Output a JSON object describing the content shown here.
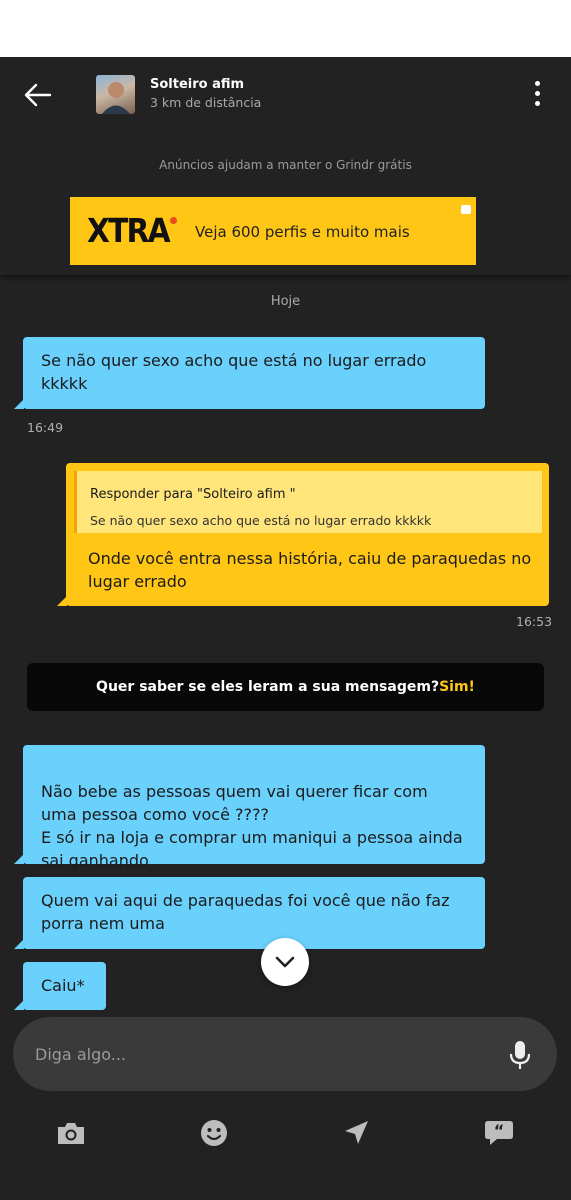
{
  "header": {
    "name": "Solteiro afim",
    "distance": "3 km de distância",
    "ad_note": "Anúncios ajudam a manter o Grindr grátis",
    "ad": {
      "logo": "XTRA",
      "text": "Veja 600 perfis e muito mais"
    }
  },
  "chat": {
    "day_label": "Hoje",
    "messages": [
      {
        "text": "Se não quer sexo acho que está no lugar errado kkkkk",
        "time": "16:49"
      },
      {
        "reply_title": "Responder para \"Solteiro afim \"",
        "reply_quote": "Se não quer sexo acho que está no lugar errado kkkkk",
        "text": "Onde você entra nessa história, caiu de paraquedas no lugar errado",
        "time": "16:53"
      },
      {
        "text": "Não bebe as pessoas  quem vai querer ficar com uma pessoa como você ????\nE só ir na loja e comprar um maniqui a pessoa ainda sai ganhando"
      },
      {
        "text": "Quem vai aqui de paraquedas foi você que não faz porra nem uma"
      },
      {
        "text": "Caiu*"
      }
    ],
    "promo": {
      "question": "Quer saber se eles leram a sua mensagem?",
      "yes": "Sim!"
    }
  },
  "composer": {
    "placeholder": "Diga algo..."
  },
  "toolbar": {
    "icons": [
      "camera-icon",
      "emoji-icon",
      "location-icon",
      "saved-phrases-icon"
    ]
  },
  "colors": {
    "incoming": "#6ad0fc",
    "outgoing": "#ffc615",
    "background": "#222222",
    "accent": "#ffc615"
  }
}
